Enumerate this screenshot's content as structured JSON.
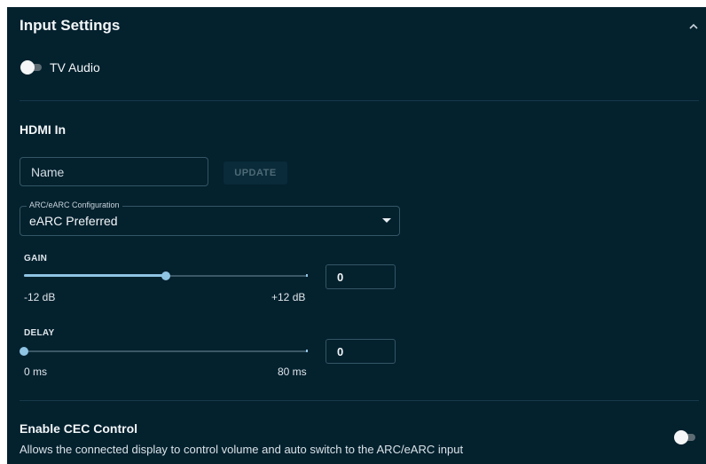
{
  "header": {
    "title": "Input Settings",
    "collapse_icon": "chevron-up-icon"
  },
  "tv_audio": {
    "label": "TV Audio",
    "enabled": false
  },
  "hdmi_in": {
    "heading": "HDMI In",
    "name_placeholder": "Name",
    "name_value": "",
    "update_label": "UPDATE"
  },
  "arc_config": {
    "legend": "ARC/eARC Configuration",
    "value": "eARC Preferred",
    "dropdown_icon": "caret-down-icon"
  },
  "gain": {
    "label": "GAIN",
    "min_label": "-12 dB",
    "max_label": "+12 dB",
    "value": "0",
    "fraction": 0.5
  },
  "delay": {
    "label": "DELAY",
    "min_label": "0 ms",
    "max_label": "80 ms",
    "value": "0",
    "fraction": 0
  },
  "cec": {
    "title": "Enable CEC Control",
    "description": "Allows the connected display to control volume and auto switch to the ARC/eARC input",
    "enabled": false
  },
  "colors": {
    "panel_bg": "#04212e",
    "accent": "#8fc4e3",
    "border": "#345665"
  }
}
